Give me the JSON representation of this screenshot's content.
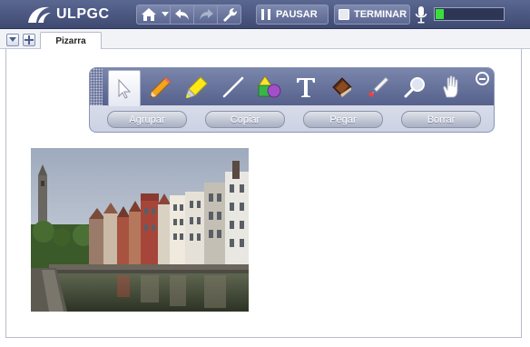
{
  "header": {
    "brand": "ULPGC",
    "pause_label": "PAUSAR",
    "stop_label": "TERMINAR",
    "audio_level": 0.12,
    "icons": [
      "logo-icon",
      "home-icon",
      "dropdown-arrow-icon",
      "undo-icon",
      "redo-icon",
      "wrench-icon",
      "pause-icon",
      "stop-icon",
      "microphone-icon"
    ]
  },
  "tabs": {
    "active": "Pizarra",
    "buttons": [
      "collapse-arrow-icon",
      "add-tab-icon"
    ]
  },
  "toolbox": {
    "tools": [
      "pointer-icon",
      "pencil-icon",
      "highlighter-icon",
      "line-icon",
      "shapes-icon",
      "text-icon",
      "eraser-icon",
      "laser-pointer-icon",
      "zoom-icon",
      "hand-icon"
    ],
    "actions": {
      "group": "Agrupar",
      "copy": "Copiar",
      "paste": "Pegar",
      "delete": "Borrar"
    }
  },
  "colors": {
    "header_bg": "#4b5680",
    "audio_meter_fill": "#3adf3a"
  }
}
